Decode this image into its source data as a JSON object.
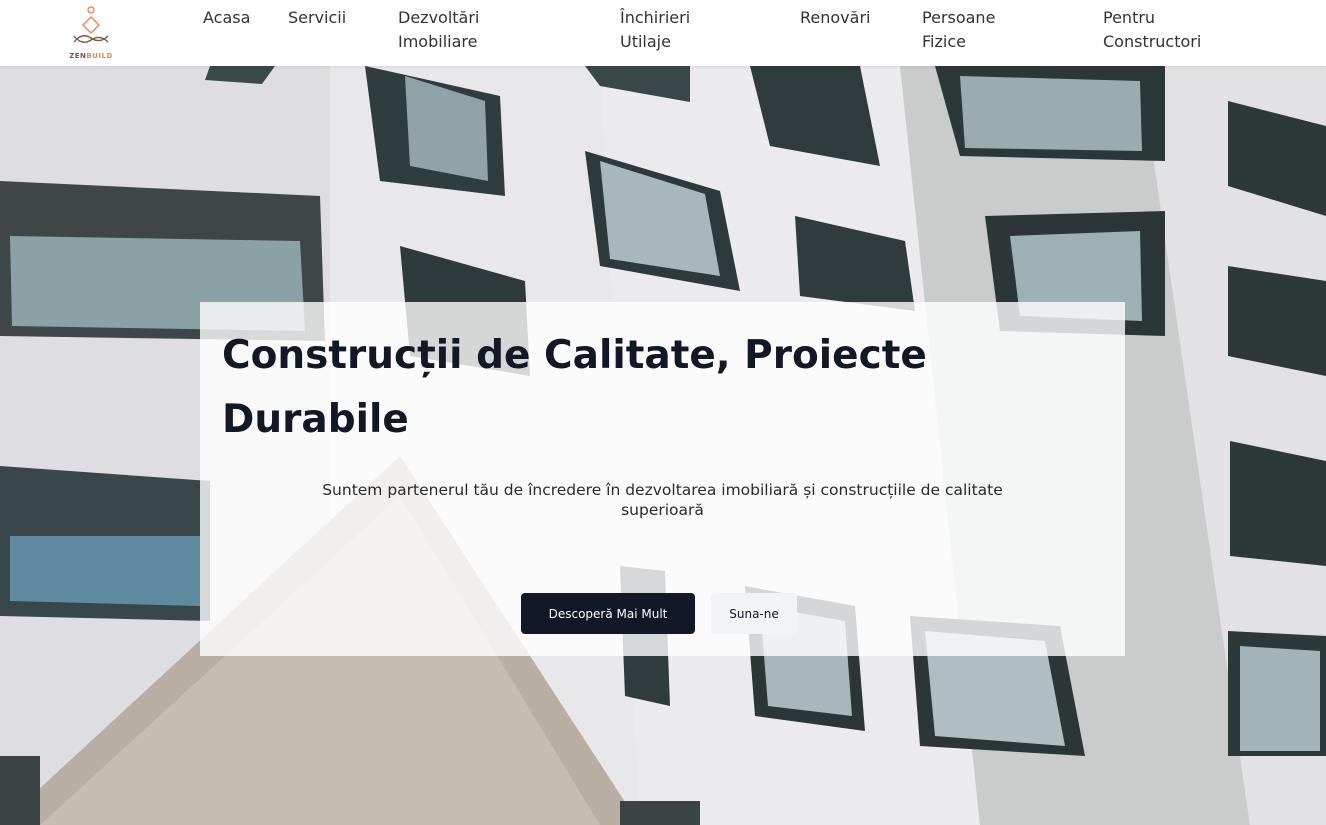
{
  "logo": {
    "name_part1": "ZEN",
    "name_part2": "BUILD",
    "icon": "zen-figure-icon"
  },
  "nav": {
    "items": [
      {
        "label_line1": "Acasa",
        "label_line2": ""
      },
      {
        "label_line1": "Servicii",
        "label_line2": ""
      },
      {
        "label_line1": "Dezvoltări",
        "label_line2": "Imobiliare"
      },
      {
        "label_line1": "Închirieri",
        "label_line2": "Utilaje"
      },
      {
        "label_line1": "Renovări",
        "label_line2": ""
      },
      {
        "label_line1": "Persoane",
        "label_line2": "Fizice"
      },
      {
        "label_line1": "Pentru",
        "label_line2": "Constructori"
      }
    ]
  },
  "hero": {
    "title_line1": "Construcții de Calitate, Proiecte",
    "title_line2": "Durabile",
    "subtitle_line1": "Suntem partenerul tău de încredere în dezvoltarea imobiliară și construcțiile de calitate",
    "subtitle_line2": "superioară",
    "primary_button": "Descoperă Mai Mult",
    "secondary_button": "Suna-ne"
  },
  "colors": {
    "primary_button_bg": "#111827",
    "secondary_button_bg": "#f1f3f7",
    "logo_accent": "#e8895a"
  }
}
